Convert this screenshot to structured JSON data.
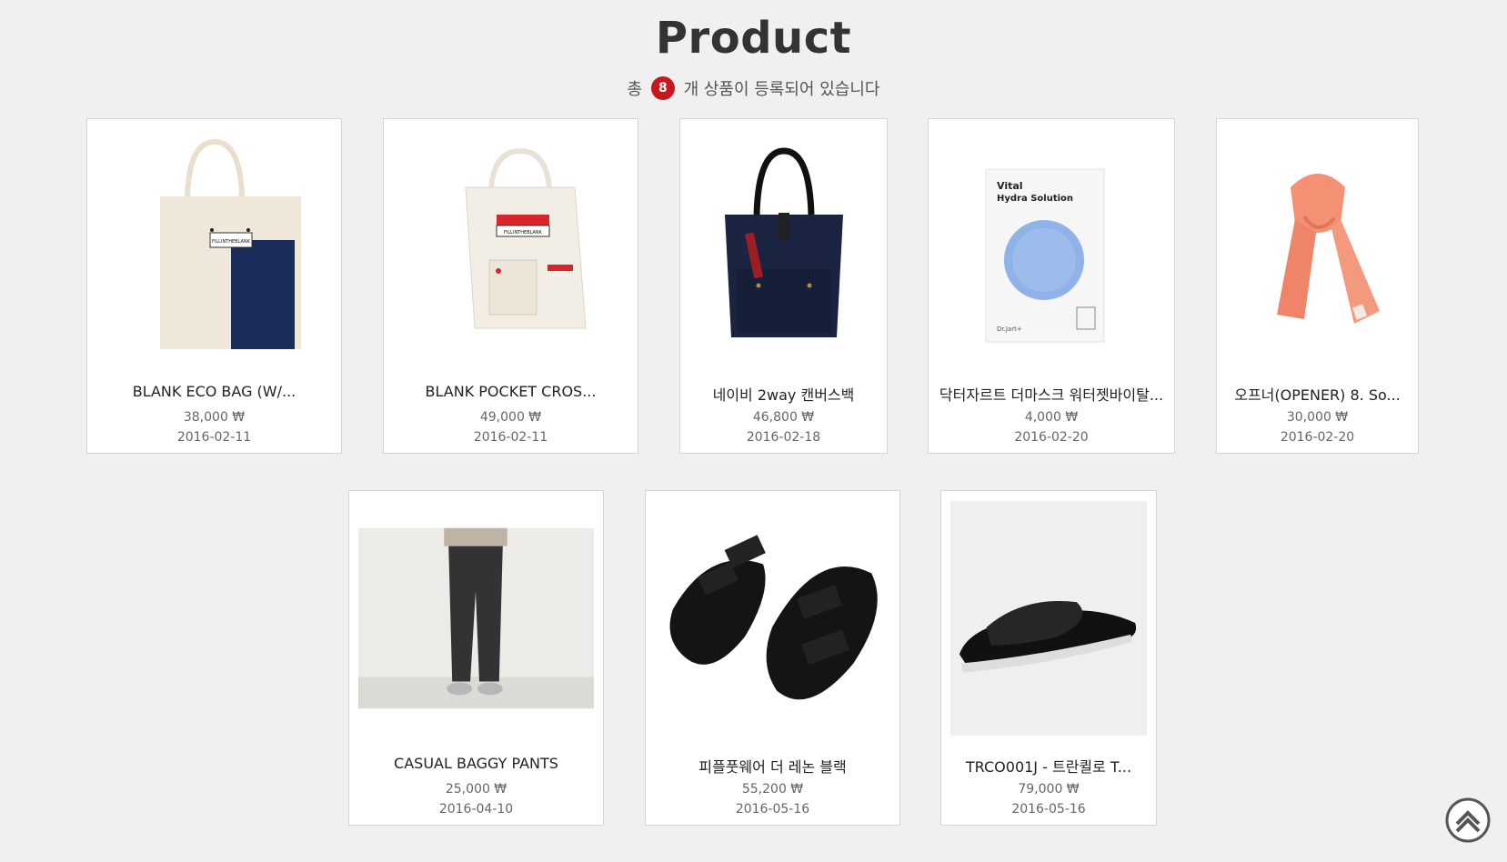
{
  "page": {
    "title": "Product",
    "count_prefix": "총",
    "count_value": "8",
    "count_suffix": "개 상품이 등록되어 있습니다"
  },
  "colors": {
    "badge": "#c8181e",
    "background": "#f0f0f0"
  },
  "products": [
    {
      "name": "BLANK ECO BAG (W/...",
      "price": "38,000 ₩",
      "date": "2016-02-11",
      "image": "eco-bag-image"
    },
    {
      "name": "BLANK POCKET CROS...",
      "price": "49,000 ₩",
      "date": "2016-02-11",
      "image": "pocket-cross-bag-image"
    },
    {
      "name": "네이비 2way 캔버스백",
      "price": "46,800 ₩",
      "date": "2016-02-18",
      "image": "navy-canvas-bag-image"
    },
    {
      "name": "닥터자르트 더마스크 워터젯바이탈...",
      "price": "4,000 ₩",
      "date": "2016-02-20",
      "image": "face-mask-image"
    },
    {
      "name": "오프너(OPENER) 8. So...",
      "price": "30,000 ₩",
      "date": "2016-02-20",
      "image": "coral-scarf-image"
    },
    {
      "name": "CASUAL BAGGY PANTS",
      "price": "25,000 ₩",
      "date": "2016-04-10",
      "image": "baggy-pants-image"
    },
    {
      "name": "피플풋웨어 더 레논 블랙",
      "price": "55,200 ₩",
      "date": "2016-05-16",
      "image": "black-sandals-image"
    },
    {
      "name": "TRCO001J - 트란퀼로 T...",
      "price": "79,000 ₩",
      "date": "2016-05-16",
      "image": "woven-slide-image"
    }
  ],
  "mask_text": {
    "brand_line1": "Vital",
    "brand_line2": "Hydra Solution",
    "maker": "Dr.Jart+"
  },
  "bag_label": "FILLINTHEBLANK",
  "scroll_top": {
    "icon": "chevron-up-icon"
  }
}
